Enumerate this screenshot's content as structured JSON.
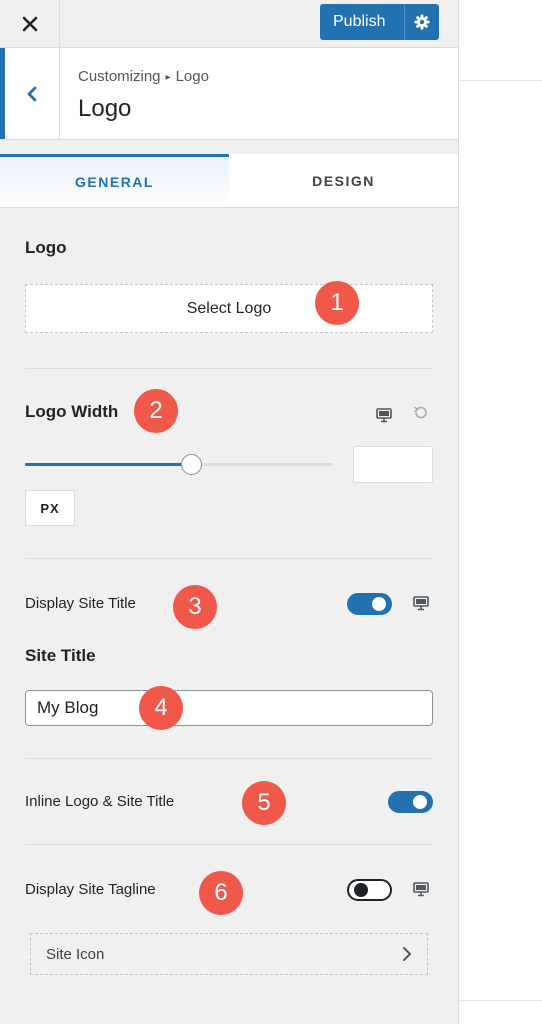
{
  "header": {
    "publish_label": "Publish"
  },
  "section": {
    "breadcrumb_prefix": "Customizing",
    "breadcrumb_current": "Logo",
    "title": "Logo"
  },
  "tabs": [
    {
      "label": "GENERAL",
      "active": true
    },
    {
      "label": "DESIGN",
      "active": false
    }
  ],
  "logo": {
    "heading": "Logo",
    "select_label": "Select Logo"
  },
  "logo_width": {
    "heading": "Logo Width",
    "slider_fraction": 0.54,
    "unit": "PX"
  },
  "display_site_title": {
    "label": "Display Site Title",
    "enabled": true
  },
  "site_title": {
    "heading": "Site Title",
    "value": "My Blog"
  },
  "inline_logo": {
    "label": "Inline Logo & Site Title",
    "enabled": true
  },
  "display_tagline": {
    "label": "Display Site Tagline",
    "enabled": false
  },
  "site_icon": {
    "label": "Site Icon"
  },
  "annotations": [
    "1",
    "2",
    "3",
    "4",
    "5",
    "6"
  ],
  "colors": {
    "accent": "#2271b1",
    "badge": "#f0584a",
    "panel_bg": "#f0f0f1"
  },
  "icons": [
    "close-icon",
    "gear-icon",
    "chevron-left-icon",
    "desktop-icon",
    "reset-icon",
    "chevron-right-icon"
  ]
}
